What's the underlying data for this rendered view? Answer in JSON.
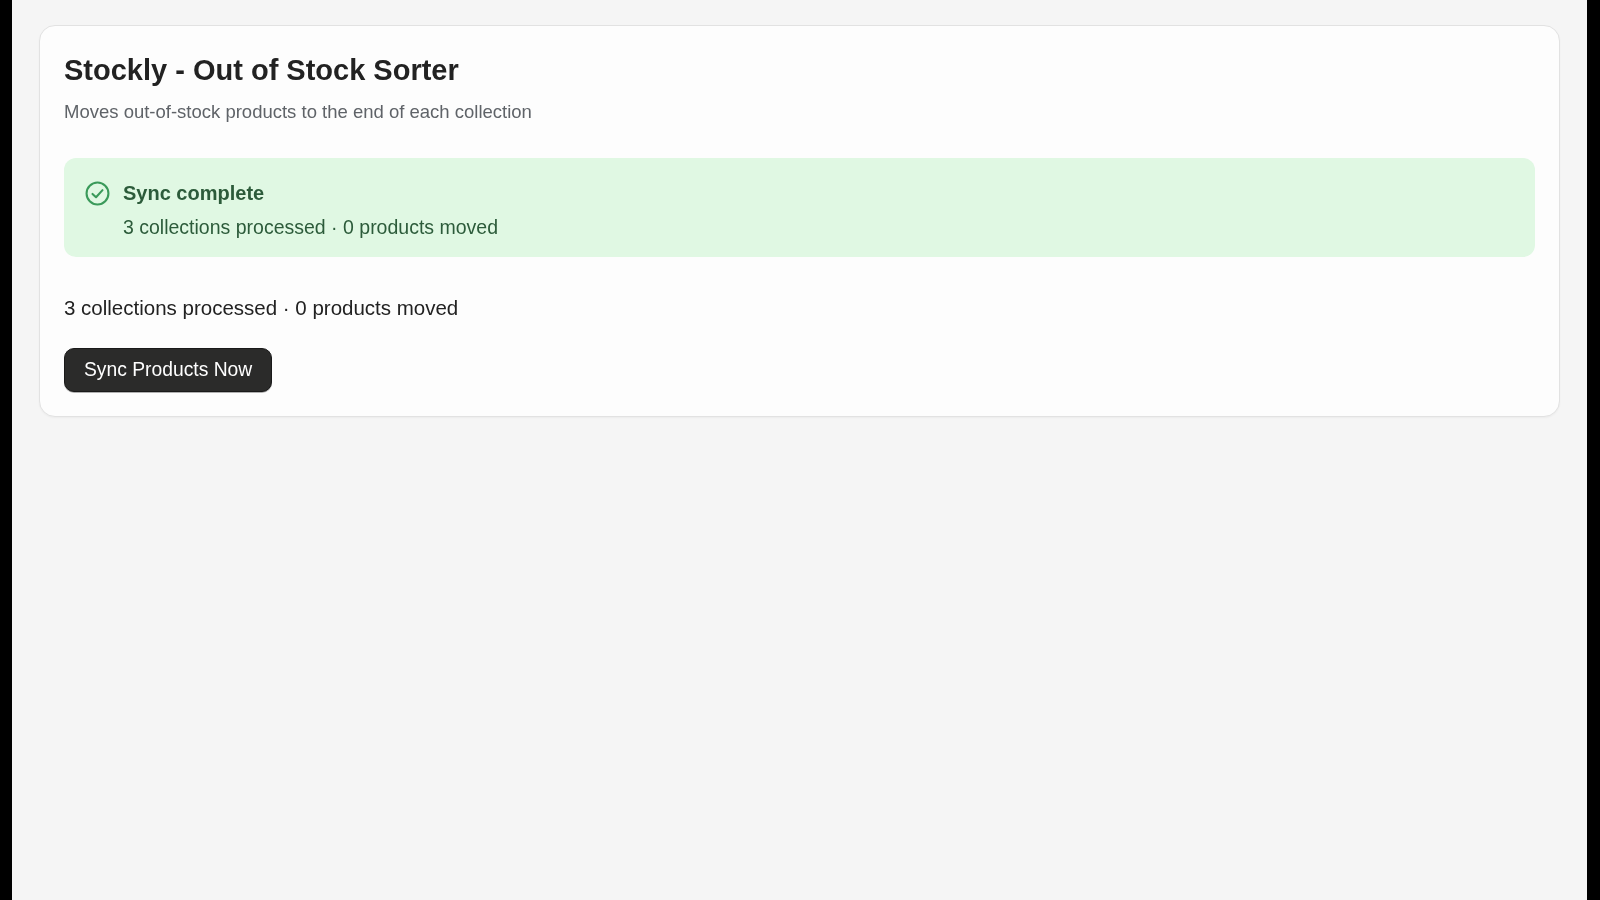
{
  "app": {
    "title": "Stockly - Out of Stock Sorter",
    "subtitle": "Moves out-of-stock products to the end of each collection"
  },
  "banner": {
    "kind": "success",
    "title": "Sync complete",
    "message": "3 collections processed · 0 products moved"
  },
  "summary": "3 collections processed · 0 products moved",
  "buttons": [
    {
      "label": "Sync Products Now"
    }
  ]
}
